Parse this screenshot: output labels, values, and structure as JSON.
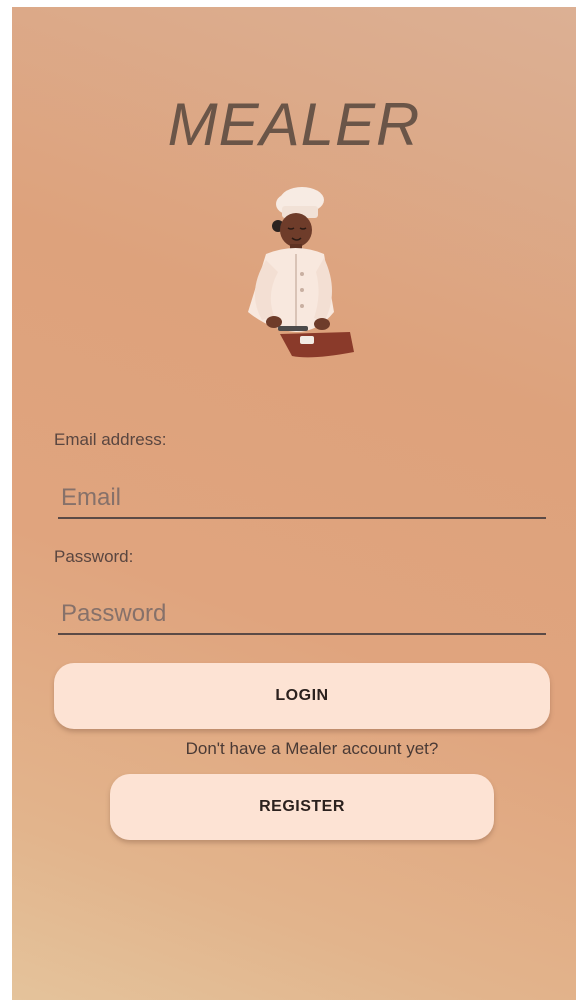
{
  "app": {
    "title": "MEALER"
  },
  "illustration": {
    "icon": "chef-cutting-illustration"
  },
  "form": {
    "email_label": "Email address:",
    "email_placeholder": "Email",
    "email_value": "",
    "password_label": "Password:",
    "password_placeholder": "Password",
    "password_value": ""
  },
  "actions": {
    "login_label": "LOGIN",
    "register_prompt": "Don't have a Mealer account yet?",
    "register_label": "REGISTER"
  },
  "colors": {
    "background_top": "#dcb094",
    "background_bottom": "#e4c39b",
    "title": "#6a5548",
    "button": "#fde3d4"
  }
}
